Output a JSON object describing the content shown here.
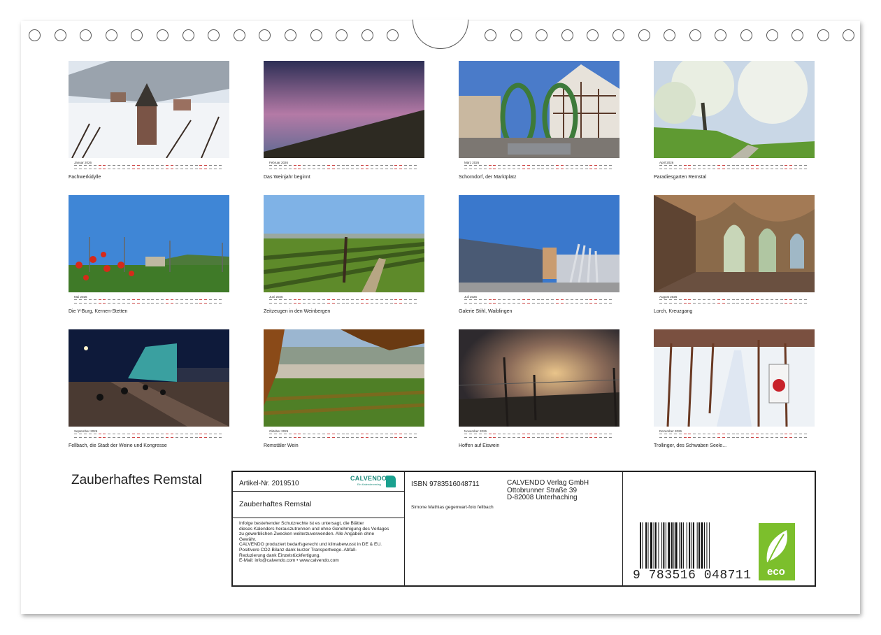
{
  "months": [
    {
      "name": "Januar",
      "year": "2026",
      "caption": "Fachwerkidylle"
    },
    {
      "name": "Februar",
      "year": "2026",
      "caption": "Das Weinjahr beginnt"
    },
    {
      "name": "März",
      "year": "2026",
      "caption": "Schorndorf, der Marktplatz"
    },
    {
      "name": "April",
      "year": "2026",
      "caption": "Paradiesgarten Remstal"
    },
    {
      "name": "Mai",
      "year": "2026",
      "caption": "Die Y-Burg, Kernen-Stetten"
    },
    {
      "name": "Juni",
      "year": "2026",
      "caption": "Zeitzeugen in den Weinbergen"
    },
    {
      "name": "Juli",
      "year": "2026",
      "caption": "Galerie Stihl, Waiblingen"
    },
    {
      "name": "August",
      "year": "2026",
      "caption": "Lorch, Kreuzgang"
    },
    {
      "name": "September",
      "year": "2026",
      "caption": "Fellbach, die Stadt der Weine und Kongresse"
    },
    {
      "name": "Oktober",
      "year": "2026",
      "caption": "Remstäler Wein"
    },
    {
      "name": "November",
      "year": "2026",
      "caption": "Hoffen auf Eiswein"
    },
    {
      "name": "Dezember",
      "year": "2026",
      "caption": "Trollinger, des Schwaben Seele..."
    }
  ],
  "title": "Zauberhaftes Remstal",
  "info": {
    "article": "Artikel-Nr. 2019510",
    "logo_word": "CALVENDO",
    "logo_sub": "Ein Kalenderverlag",
    "title": "Zauberhaftes Remstal",
    "legal": [
      "Infolge bestehender Schutzrechte ist es untersagt, die Blätter",
      "dieses Kalenders herauszutrennen und ohne Genehmigung des Verlages",
      "zu gewerblichen Zwecken weiterzuverwenden. Alle Angaben ohne",
      "Gewähr.",
      "CALVENDO produziert bedarfsgerecht und klimabewusst in DE & EU.",
      "Positivere CO2-Bilanz dank kurzer Transportwege. Abfall-",
      "Reduzierung dank Einzelstückfertigung.",
      "E-Mail: info@calvendo.com • www.calvendo.com"
    ],
    "isbn": "ISBN 9783516048711",
    "publisher": [
      "CALVENDO Verlag GmbH",
      "Ottobrunner Straße 39",
      "D-82008 Unterhaching"
    ],
    "author": "Simone Mathias gegenwart-foto fellbach",
    "barcode_digits": "9 783516 048711",
    "eco_label": "eco"
  },
  "colors": {
    "logo": "#1a8a7a",
    "eco": "#7cbf2c",
    "weekend": "#c44444"
  }
}
